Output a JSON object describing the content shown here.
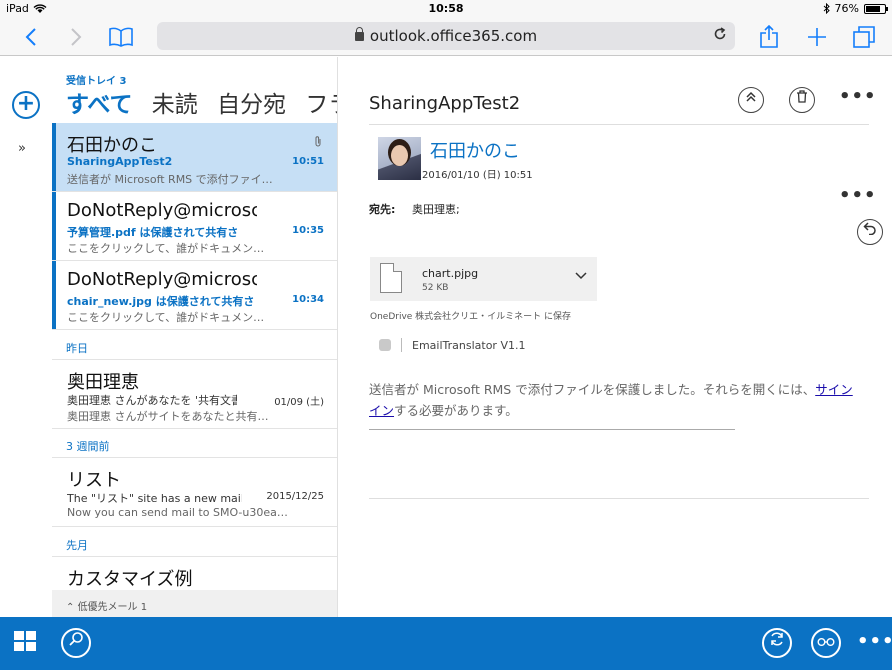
{
  "status_bar": {
    "device": "iPad",
    "time": "10:58",
    "battery": "76%"
  },
  "browser": {
    "url": "outlook.office365.com"
  },
  "list": {
    "folder_label": "受信トレイ 3",
    "pivots": [
      "すべて",
      "未読",
      "自分宛",
      "フラ"
    ],
    "messages": [
      {
        "sender": "石田かのこ",
        "subject": "SharingAppTest2",
        "preview": "送信者が Microsoft RMS で添付ファイ…",
        "time": "10:51"
      },
      {
        "sender": "DoNotReply@microsc",
        "subject": "予算管理.pdf は保護されて共有さ",
        "preview": "ここをクリックして、誰がドキュメン…",
        "time": "10:35"
      },
      {
        "sender": "DoNotReply@microsc",
        "subject": "chair_new.jpg は保護されて共有さ",
        "preview": "ここをクリックして、誰がドキュメン…",
        "time": "10:34"
      },
      {
        "sender": "奥田理恵",
        "subject": "奥田理恵 さんがあなたを '共有文書",
        "preview": "奥田理恵 さんがサイトをあなたと共有…",
        "time": "01/09 (土)"
      },
      {
        "sender": "リスト",
        "subject": "The \"リスト\" site has a new mailbo",
        "preview": "Now you can send mail to SMO-u30ea…",
        "time": "2015/12/25"
      },
      {
        "sender": "カスタマイズ例"
      }
    ],
    "groups": [
      "昨日",
      "3 週間前",
      "先月"
    ],
    "low_priority": "低優先メール 1"
  },
  "reader": {
    "title": "SharingAppTest2",
    "from_name": "石田かのこ",
    "from_date": "2016/01/10 (日) 10:51",
    "to_label": "宛先:",
    "to_value": "奥田理恵;",
    "attachment": {
      "name": "chart.pjpg",
      "size": "52 KB"
    },
    "onedrive_save": "OneDrive 株式会社クリエ・イルミネート に保存",
    "addin": "EmailTranslator V1.1",
    "body_before_link": "送信者が Microsoft RMS で添付ファイルを保護しました。それらを開くには、",
    "body_link": "サインイン",
    "body_after_link": "する必要があります。"
  },
  "icons": {
    "back": "chevron-left-icon",
    "forward": "chevron-right-icon",
    "bookmarks": "book-icon",
    "share": "share-icon",
    "new_tab": "plus-icon",
    "tabs": "tabs-icon",
    "compose": "plus-circle-icon",
    "expand": "double-chevron-right-icon",
    "collapse_up": "double-chevron-up-icon",
    "delete": "trash-icon",
    "reply": "reply-icon",
    "app_launcher": "app-grid-icon",
    "search": "search-icon",
    "sync": "sync-icon",
    "glasses": "glasses-icon"
  },
  "colors": {
    "accent": "#0b72c4",
    "selected_row": "#c6dff5"
  }
}
